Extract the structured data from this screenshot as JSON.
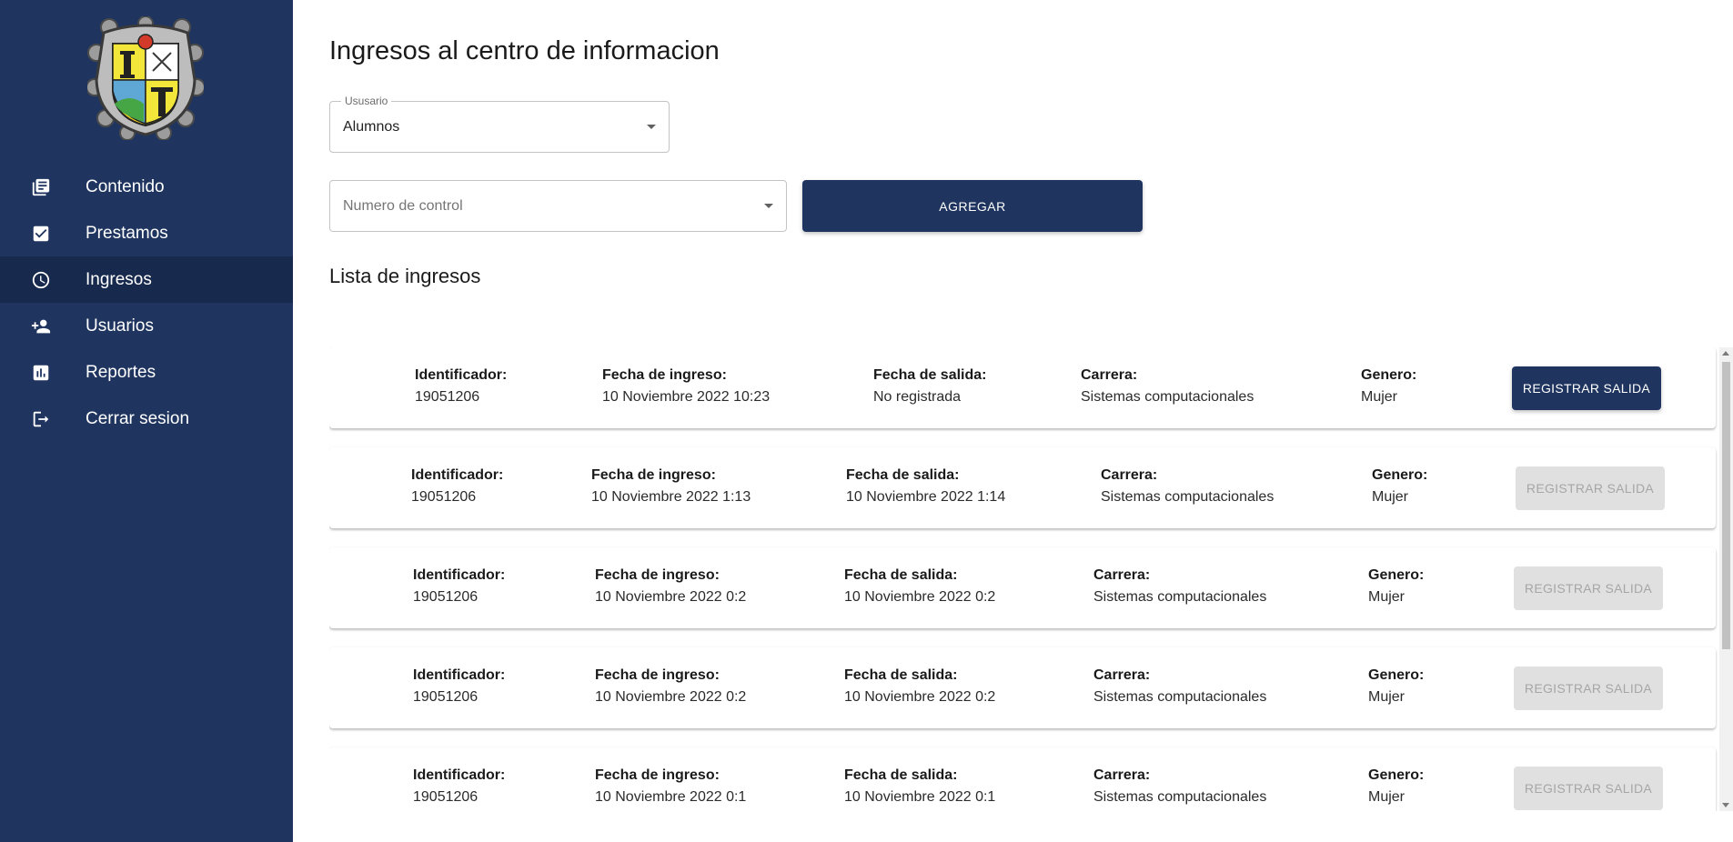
{
  "sidebar": {
    "logo_icon": "institution-crest-icon",
    "items": [
      {
        "label": "Contenido",
        "icon": "library-books-icon",
        "active": false
      },
      {
        "label": "Prestamos",
        "icon": "checkbox-icon",
        "active": false
      },
      {
        "label": "Ingresos",
        "icon": "clock-icon",
        "active": true
      },
      {
        "label": "Usuarios",
        "icon": "person-add-icon",
        "active": false
      },
      {
        "label": "Reportes",
        "icon": "bar-chart-icon",
        "active": false
      },
      {
        "label": "Cerrar sesion",
        "icon": "logout-icon",
        "active": false
      }
    ]
  },
  "main": {
    "title": "Ingresos al centro de informacion",
    "usuario_select": {
      "label": "Ususario",
      "value": "Alumnos"
    },
    "control_select": {
      "placeholder": "Numero de control"
    },
    "agregar_label": "AGREGAR",
    "list_title": "Lista de ingresos",
    "field_labels": {
      "id": "Identificador:",
      "ingreso": "Fecha de ingreso:",
      "salida": "Fecha de salida:",
      "carrera": "Carrera:",
      "genero": "Genero:"
    },
    "button_label": "REGISTRAR SALIDA",
    "entries": [
      {
        "id": "19051206",
        "ingreso": "10 Noviembre 2022 10:23",
        "salida": "No registrada",
        "carrera": "Sistemas computacionales",
        "genero": "Mujer",
        "enabled": true
      },
      {
        "id": "19051206",
        "ingreso": "10 Noviembre 2022 1:13",
        "salida": "10 Noviembre 2022 1:14",
        "carrera": "Sistemas computacionales",
        "genero": "Mujer",
        "enabled": false
      },
      {
        "id": "19051206",
        "ingreso": "10 Noviembre 2022 0:2",
        "salida": "10 Noviembre 2022 0:2",
        "carrera": "Sistemas computacionales",
        "genero": "Mujer",
        "enabled": false
      },
      {
        "id": "19051206",
        "ingreso": "10 Noviembre 2022 0:2",
        "salida": "10 Noviembre 2022 0:2",
        "carrera": "Sistemas computacionales",
        "genero": "Mujer",
        "enabled": false
      },
      {
        "id": "19051206",
        "ingreso": "10 Noviembre 2022 0:1",
        "salida": "10 Noviembre 2022 0:1",
        "carrera": "Sistemas computacionales",
        "genero": "Mujer",
        "enabled": false
      }
    ]
  },
  "colors": {
    "sidebar": "#1f3560",
    "sidebar_active": "#172a4d",
    "button": "#1f3560",
    "button_disabled": "#e0e0e0"
  }
}
